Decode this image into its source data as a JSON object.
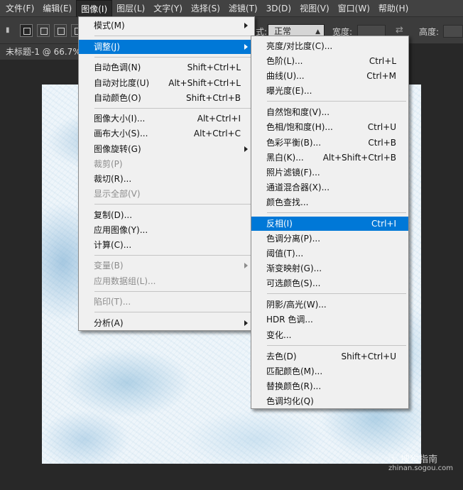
{
  "menubar": {
    "items": [
      "文件(F)",
      "编辑(E)",
      "图像(I)",
      "图层(L)",
      "文字(Y)",
      "选择(S)",
      "滤镜(T)",
      "3D(D)",
      "视图(V)",
      "窗口(W)",
      "帮助(H)"
    ],
    "active": "图像(I)"
  },
  "options_bar": {
    "mode_label": "正常",
    "width_label": "宽度:",
    "height_label": "高度:",
    "mode_prefix": "式:"
  },
  "document": {
    "tab_title": "未标题-1 @ 66.7%"
  },
  "image_menu": {
    "items": [
      {
        "label": "模式(M)",
        "shortcut": "",
        "submenu": true,
        "disabled": false
      },
      {
        "separator": true
      },
      {
        "label": "调整(J)",
        "shortcut": "",
        "submenu": true,
        "disabled": false,
        "highlighted": true
      },
      {
        "separator": true
      },
      {
        "label": "自动色调(N)",
        "shortcut": "Shift+Ctrl+L",
        "submenu": false,
        "disabled": false
      },
      {
        "label": "自动对比度(U)",
        "shortcut": "Alt+Shift+Ctrl+L",
        "submenu": false,
        "disabled": false
      },
      {
        "label": "自动颜色(O)",
        "shortcut": "Shift+Ctrl+B",
        "submenu": false,
        "disabled": false
      },
      {
        "separator": true
      },
      {
        "label": "图像大小(I)...",
        "shortcut": "Alt+Ctrl+I",
        "submenu": false,
        "disabled": false
      },
      {
        "label": "画布大小(S)...",
        "shortcut": "Alt+Ctrl+C",
        "submenu": false,
        "disabled": false
      },
      {
        "label": "图像旋转(G)",
        "shortcut": "",
        "submenu": true,
        "disabled": false
      },
      {
        "label": "裁剪(P)",
        "shortcut": "",
        "submenu": false,
        "disabled": true
      },
      {
        "label": "裁切(R)...",
        "shortcut": "",
        "submenu": false,
        "disabled": false
      },
      {
        "label": "显示全部(V)",
        "shortcut": "",
        "submenu": false,
        "disabled": true
      },
      {
        "separator": true
      },
      {
        "label": "复制(D)...",
        "shortcut": "",
        "submenu": false,
        "disabled": false
      },
      {
        "label": "应用图像(Y)...",
        "shortcut": "",
        "submenu": false,
        "disabled": false
      },
      {
        "label": "计算(C)...",
        "shortcut": "",
        "submenu": false,
        "disabled": false
      },
      {
        "separator": true
      },
      {
        "label": "变量(B)",
        "shortcut": "",
        "submenu": true,
        "disabled": true
      },
      {
        "label": "应用数据组(L)...",
        "shortcut": "",
        "submenu": false,
        "disabled": true
      },
      {
        "separator": true
      },
      {
        "label": "陷印(T)...",
        "shortcut": "",
        "submenu": false,
        "disabled": true
      },
      {
        "separator": true
      },
      {
        "label": "分析(A)",
        "shortcut": "",
        "submenu": true,
        "disabled": false
      }
    ]
  },
  "adjust_menu": {
    "items": [
      {
        "label": "亮度/对比度(C)...",
        "shortcut": ""
      },
      {
        "label": "色阶(L)...",
        "shortcut": "Ctrl+L"
      },
      {
        "label": "曲线(U)...",
        "shortcut": "Ctrl+M"
      },
      {
        "label": "曝光度(E)...",
        "shortcut": ""
      },
      {
        "separator": true
      },
      {
        "label": "自然饱和度(V)...",
        "shortcut": ""
      },
      {
        "label": "色相/饱和度(H)...",
        "shortcut": "Ctrl+U"
      },
      {
        "label": "色彩平衡(B)...",
        "shortcut": "Ctrl+B"
      },
      {
        "label": "黑白(K)...",
        "shortcut": "Alt+Shift+Ctrl+B"
      },
      {
        "label": "照片滤镜(F)...",
        "shortcut": ""
      },
      {
        "label": "通道混合器(X)...",
        "shortcut": ""
      },
      {
        "label": "颜色查找...",
        "shortcut": ""
      },
      {
        "separator": true
      },
      {
        "label": "反相(I)",
        "shortcut": "Ctrl+I",
        "highlighted": true
      },
      {
        "label": "色调分离(P)...",
        "shortcut": ""
      },
      {
        "label": "阈值(T)...",
        "shortcut": ""
      },
      {
        "label": "渐变映射(G)...",
        "shortcut": ""
      },
      {
        "label": "可选颜色(S)...",
        "shortcut": ""
      },
      {
        "separator": true
      },
      {
        "label": "阴影/高光(W)...",
        "shortcut": ""
      },
      {
        "label": "HDR 色调...",
        "shortcut": ""
      },
      {
        "label": "变化...",
        "shortcut": ""
      },
      {
        "separator": true
      },
      {
        "label": "去色(D)",
        "shortcut": "Shift+Ctrl+U"
      },
      {
        "label": "匹配颜色(M)...",
        "shortcut": ""
      },
      {
        "label": "替换颜色(R)...",
        "shortcut": ""
      },
      {
        "label": "色调均化(Q)",
        "shortcut": ""
      }
    ]
  },
  "watermark": {
    "text": "ⓢ 搜狗指南",
    "url": "zhinan.sogou.com"
  },
  "colors": {
    "highlight": "#0078d7",
    "menu_bg": "#f0f0f0",
    "app_bg": "#282828"
  }
}
